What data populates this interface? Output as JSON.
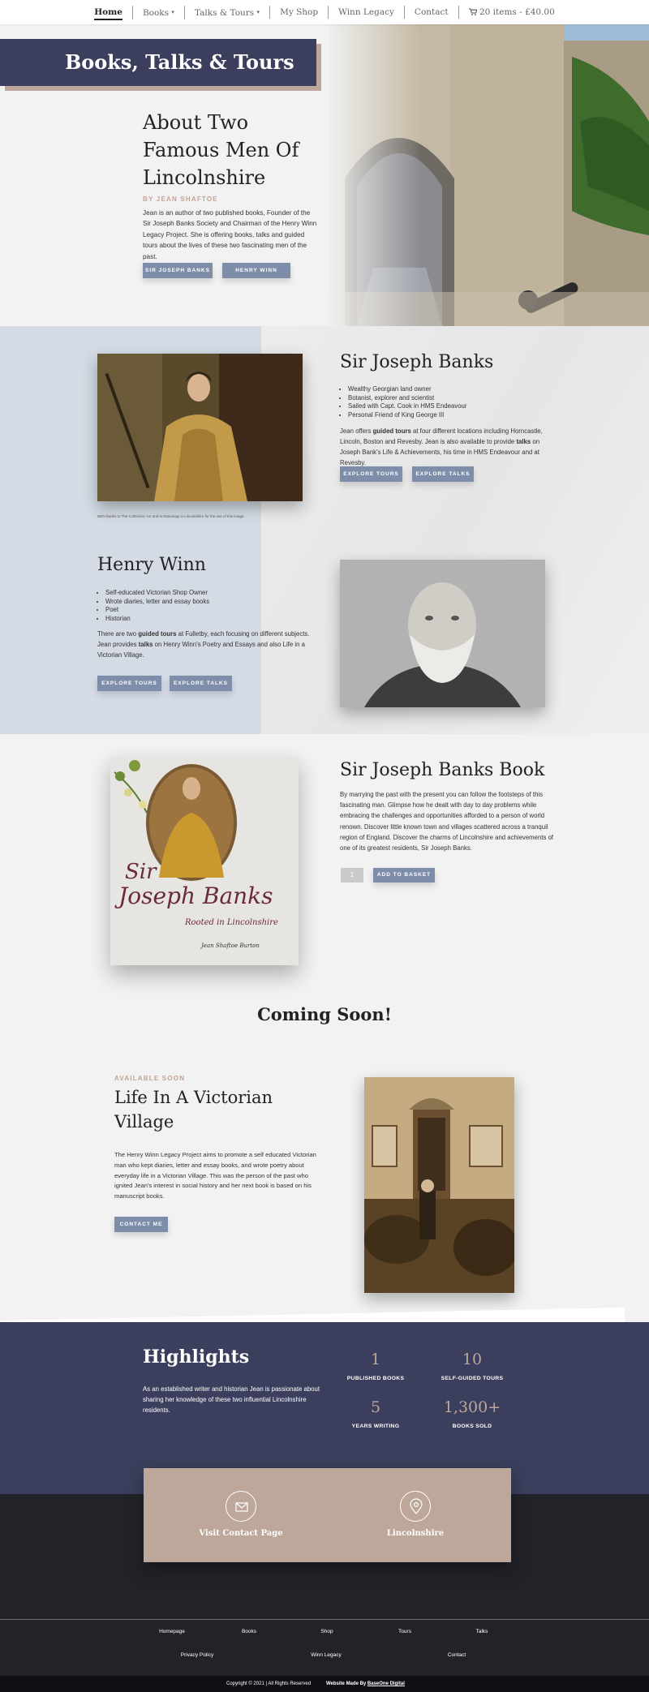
{
  "nav": {
    "items": [
      {
        "label": "Home"
      },
      {
        "label": "Books",
        "caret": "▾"
      },
      {
        "label": "Talks & Tours",
        "caret": "▾"
      },
      {
        "label": "My Shop"
      },
      {
        "label": "Winn Legacy"
      },
      {
        "label": "Contact"
      },
      {
        "label": "20 items - £40.00",
        "icon": "cart-icon"
      }
    ]
  },
  "hero": {
    "banner": "Books, Talks & Tours",
    "title_line1": "About Two",
    "title_line2": "Famous Men Of",
    "title_line3": "Lincolnshire",
    "kicker": "BY JEAN SHAFTOE",
    "text": "Jean is an author of two published books, Founder of the Sir Joseph Banks Society and Chairman of the Henry Winn Legacy Project. She is offering books, talks and guided tours about the lives of these two fascinating men of the past.",
    "btn1": "SIR JOSEPH BANKS",
    "btn2": "HENRY WINN"
  },
  "banks": {
    "title": "Sir Joseph Banks",
    "bullets": [
      "Wealthy Georgian land owner",
      "Botanist, explorer and scientist",
      "Sailed with Capt. Cook in HMS Endeavour",
      "Personal Friend of King George III"
    ],
    "text_a": "Jean offers ",
    "text_b": "guided tours",
    "text_c": " at four different locations including Horncastle, Lincoln, Boston and Revesby. Jean is also available to provide ",
    "text_d": "talks",
    "text_e": " on Joseph Bank's Life & Achievements, his time in HMS Endeavour and at Revesby.",
    "btn1": "EXPLORE TOURS",
    "btn2": "EXPLORE TALKS",
    "caption": "With thanks to The Collection: Art and Archaeology in Lincolnshire for the use of this image."
  },
  "winn": {
    "title": "Henry Winn",
    "bullets": [
      "Self-educated Victorian Shop Owner",
      "Wrote diaries, letter and essay books",
      "Poet",
      "Historian"
    ],
    "text_a": "There are two ",
    "text_b": "guided tours",
    "text_c": " at Fulletby, each focusing on different subjects. Jean provides ",
    "text_d": "talks",
    "text_e": " on Henry Winn's Poetry and Essays and also Life in a Victorian Village.",
    "btn1": "EXPLORE TOURS",
    "btn2": "EXPLORE TALKS"
  },
  "book": {
    "title": "Sir Joseph Banks Book",
    "text": "By marrying the past with the present you can follow the footsteps of this fascinating man. Glimpse how he dealt with day to day problems while embracing the challenges and opportunities afforded to a person of world renown. Discover little known town and villages scattered across a tranquil region of England. Discover the charms of Lincolnshire and achievements of one of its greatest residents, Sir Joseph Banks.",
    "qty": "1",
    "add_btn": "ADD TO BASKET",
    "cover_title1": "Sir",
    "cover_title2": "Joseph Banks",
    "cover_sub": "Rooted in Lincolnshire",
    "cover_author": "Jean Shaftoe Burton"
  },
  "coming": {
    "heading": "Coming Soon!",
    "kicker": "AVAILABLE SOON",
    "title_line1": "Life In A Victorian",
    "title_line2": "Village",
    "text": "The Henry Winn Legacy Project aims to promote a self educated Victorian man who kept diaries, letter and essay books, and wrote poetry about everyday life in a Victorian Village. This was the person of the past who ignited Jean's interest in social history and her next book is based on his manuscript books.",
    "btn": "CONTACT ME"
  },
  "highlights": {
    "title": "Highlights",
    "text": "As an established writer and historian Jean is passionate about sharing her knowledge of these two influential Lincolnshire residents.",
    "stats": [
      {
        "value": "1",
        "label": "PUBLISHED BOOKS"
      },
      {
        "value": "10",
        "label": "SELF-GUIDED TOURS"
      },
      {
        "value": "5",
        "label": "YEARS WRITING"
      },
      {
        "value": "1,300+",
        "label": "BOOKS SOLD"
      }
    ]
  },
  "contact_card": {
    "item1": "Visit Contact Page",
    "item2": "Lincolnshire"
  },
  "footer": {
    "row1": [
      "Homepage",
      "Books",
      "Shop",
      "Tours",
      "Talks"
    ],
    "row2": [
      "Privacy Policy",
      "Winn Legacy",
      "Contact"
    ],
    "copyright": "Copyright © 2021 | All Rights Reserved",
    "made_by": "Website Made By ",
    "made_by_link": "BaseOne Digital"
  },
  "colors": {
    "navy": "#3b3f5d",
    "accent_tan": "#bca79a",
    "button_blue": "#7e8eaa",
    "dark": "#212329"
  }
}
